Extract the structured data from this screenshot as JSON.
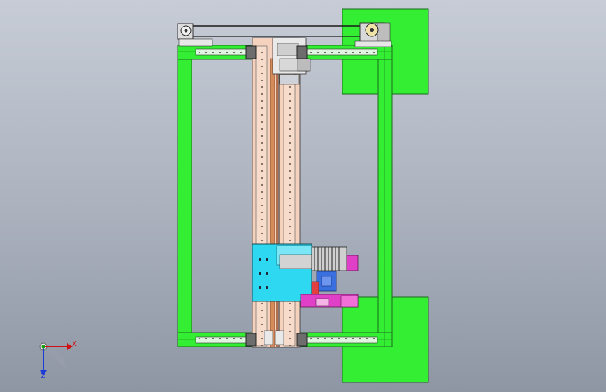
{
  "viewport": {
    "background_top": "#c7ccd6",
    "background_bottom": "#8e96a4"
  },
  "colors": {
    "frame_green": "#33ee33",
    "frame_stroke": "#1a6a1a",
    "rail_salmon": "#f4d2bd",
    "carriage_cyan": "#2ed8f0",
    "motor_blue": "#3a6fe0",
    "magenta": "#e040c8",
    "belt": "#1b1b1b",
    "gear_grey": "#c8c8c8",
    "axis_x": "#d01010",
    "axis_y": "#10a010",
    "axis_z": "#1d3bd6"
  },
  "triad": {
    "x_label": "X",
    "z_label": "Z"
  }
}
